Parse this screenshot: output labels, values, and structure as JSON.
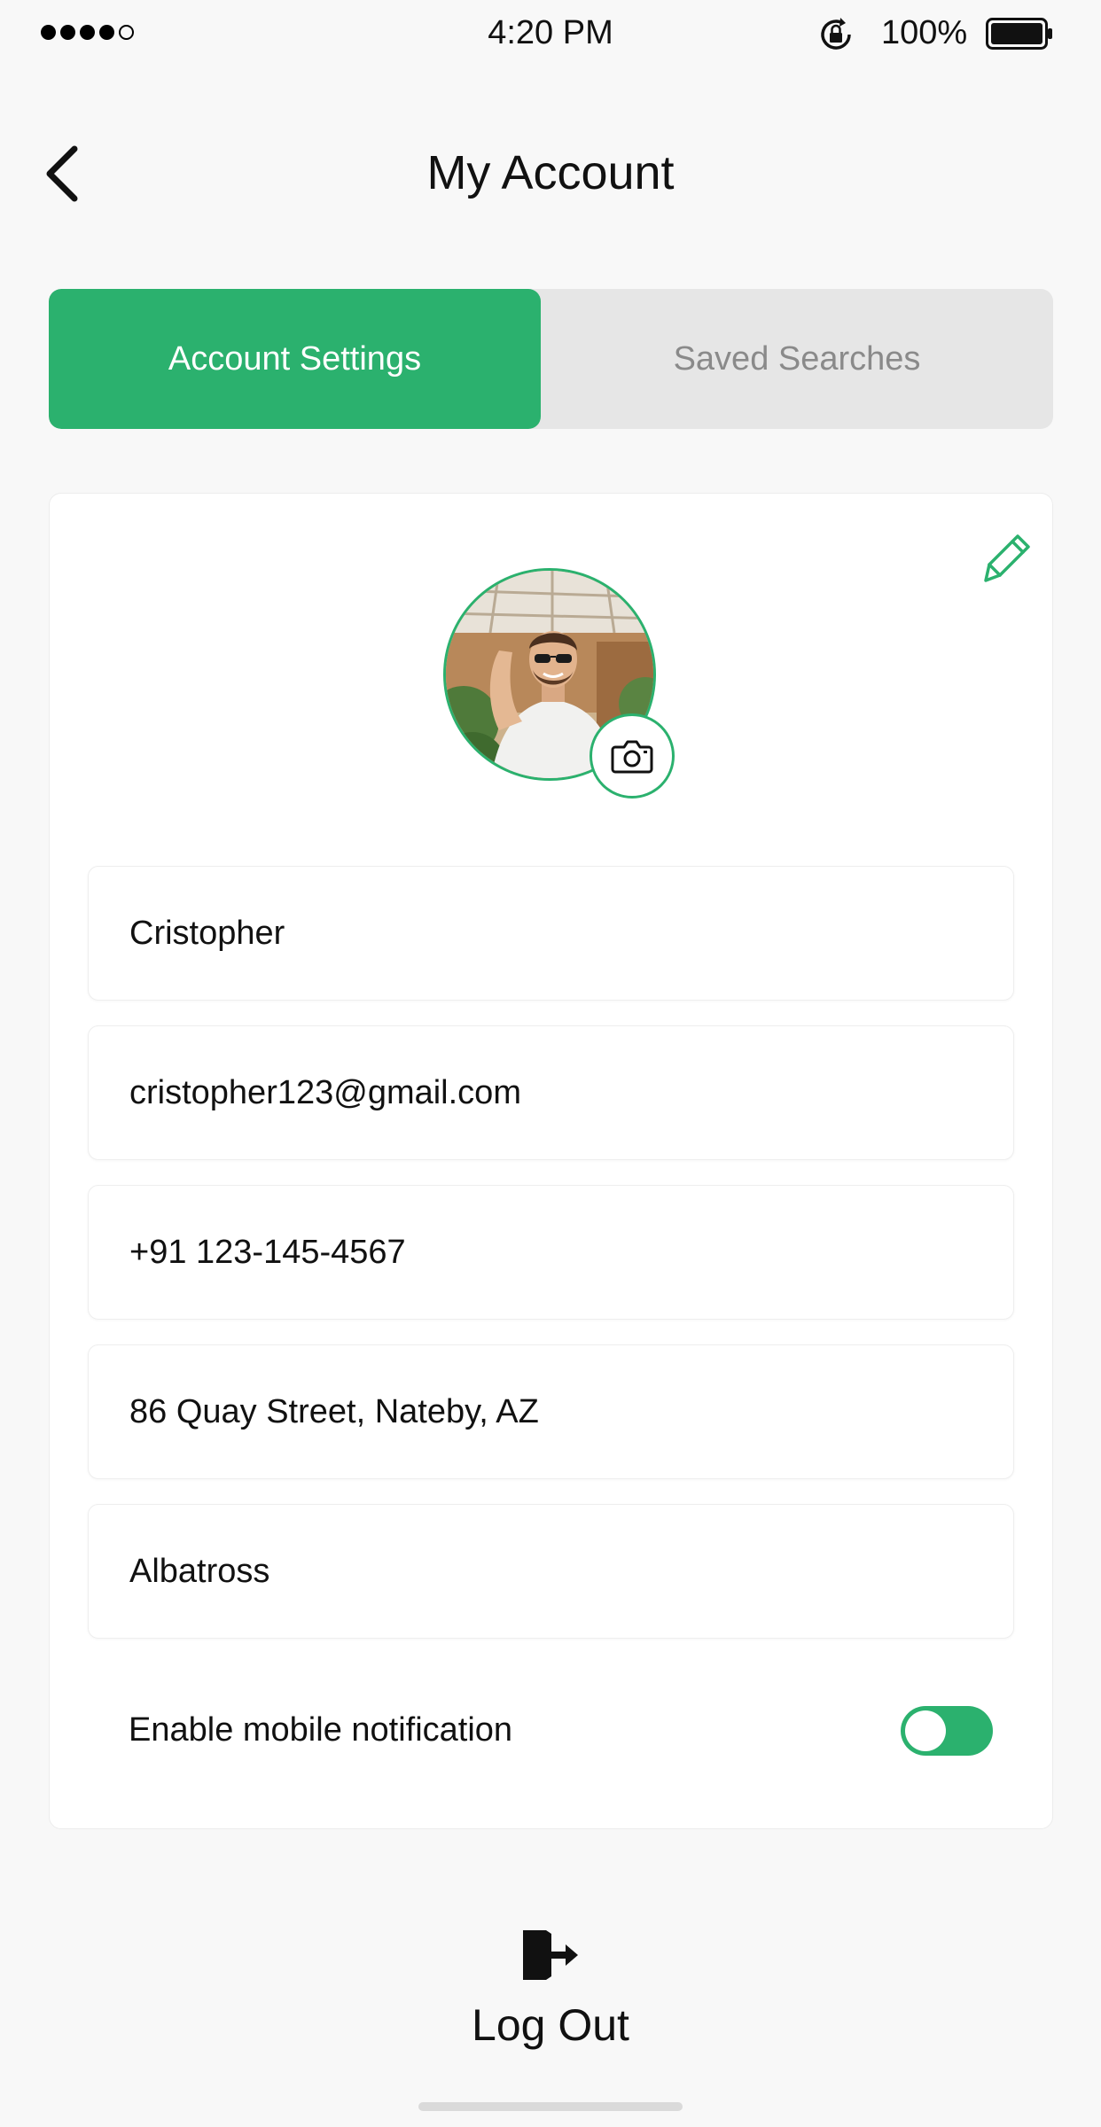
{
  "status_bar": {
    "time": "4:20 PM",
    "battery": "100%"
  },
  "header": {
    "title": "My Account"
  },
  "tabs": [
    {
      "label": "Account Settings",
      "active": true
    },
    {
      "label": "Saved Searches",
      "active": false
    }
  ],
  "profile": {
    "name": "Cristopher",
    "email": "cristopher123@gmail.com",
    "phone": "+91 123-145-4567",
    "address": "86 Quay Street, Nateby, AZ",
    "company": "Albatross"
  },
  "notifications": {
    "label": "Enable mobile notification",
    "enabled": true
  },
  "logout": {
    "label": "Log Out"
  },
  "colors": {
    "accent": "#2bb16e",
    "background": "#f8f8f8",
    "tab_inactive": "#e6e6e6"
  },
  "icons": [
    "back-chevron-icon",
    "pencil-icon",
    "camera-icon",
    "logout-door-icon",
    "rotation-lock-icon",
    "battery-icon"
  ]
}
